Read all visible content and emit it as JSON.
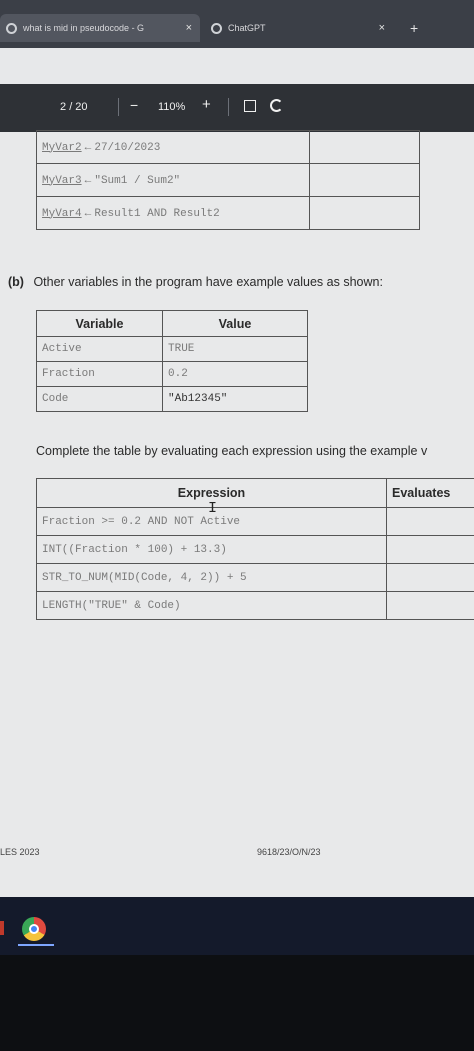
{
  "browser": {
    "tabs": [
      {
        "title": "what is mid in pseudocode - G",
        "close": "×"
      },
      {
        "title": "ChatGPT",
        "close": "×"
      }
    ],
    "new_tab": "+"
  },
  "pdf_toolbar": {
    "page": "2",
    "page_total": "/ 20",
    "zoom": "110%",
    "zoom_out": "−",
    "zoom_in": "+"
  },
  "table_top": {
    "rows": [
      {
        "var": "MyVar2",
        "arrow": "←",
        "value": "27/10/2023"
      },
      {
        "var": "MyVar3",
        "arrow": "←",
        "value": "\"Sum1 / Sum2\""
      },
      {
        "var": "MyVar4",
        "arrow": "←",
        "value": "Result1 AND Result2"
      }
    ]
  },
  "part_b": {
    "label": "(b)",
    "text": "Other variables in the program have example values as shown:"
  },
  "variables_table": {
    "headers": [
      "Variable",
      "Value"
    ],
    "rows": [
      [
        "Active",
        "TRUE"
      ],
      [
        "Fraction",
        "0.2"
      ],
      [
        "Code",
        "\"Ab12345\""
      ]
    ]
  },
  "instruction": "Complete the table by evaluating each expression using the example v",
  "expression_table": {
    "headers": [
      "Expression",
      "Evaluates"
    ],
    "rows": [
      "Fraction >= 0.2 AND NOT Active",
      "INT((Fraction * 100) + 13.3)",
      "STR_TO_NUM(MID(Code, 4, 2)) + 5",
      "LENGTH(\"TRUE\" & Code)"
    ]
  },
  "footer": {
    "left": "LES 2023",
    "right": "9618/23/O/N/23"
  }
}
